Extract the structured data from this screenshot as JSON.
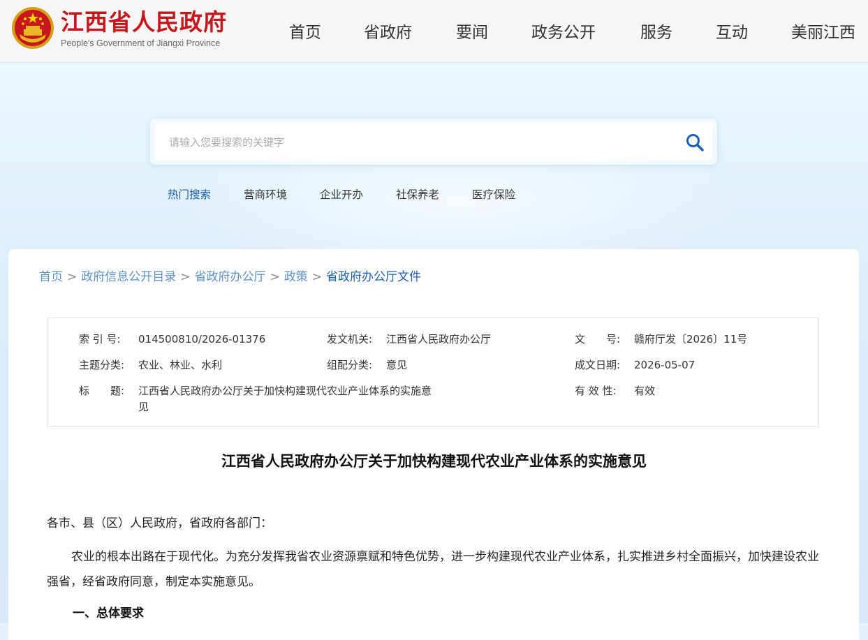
{
  "header": {
    "logo_cn": "江西省人民政府",
    "logo_en": "People's Government of Jiangxi Province",
    "nav": [
      "首页",
      "省政府",
      "要闻",
      "政务公开",
      "服务",
      "互动",
      "美丽江西"
    ]
  },
  "search": {
    "placeholder": "请输入您要搜索的关键字",
    "hot_label": "热门搜索",
    "hot_items": [
      "营商环境",
      "企业开办",
      "社保养老",
      "医疗保险"
    ]
  },
  "breadcrumb": {
    "items": [
      "首页",
      "政府信息公开目录",
      "省政府办公厅",
      "政策"
    ],
    "current": "省政府办公厅文件",
    "separator": ">"
  },
  "meta": {
    "index_label": "索 引 号:",
    "index_value": "014500810/2026-01376",
    "issuer_label": "发文机关:",
    "issuer_value": "江西省人民政府办公厅",
    "docno_label": "文　　号:",
    "docno_value": "赣府厅发〔2026〕11号",
    "topic_label": "主题分类:",
    "topic_value": "农业、林业、水利",
    "genre_label": "组配分类:",
    "genre_value": "意见",
    "date_label": "成文日期:",
    "date_value": "2026-05-07",
    "title_label": "标　　题:",
    "title_value": "江西省人民政府办公厅关于加快构建现代农业产业体系的实施意见",
    "validity_label": "有 效 性:",
    "validity_value": "有效"
  },
  "document": {
    "title": "江西省人民政府办公厅关于加快构建现代农业产业体系的实施意见",
    "salutation": "各市、县（区）人民政府，省政府各部门：",
    "intro": "农业的根本出路在于现代化。为充分发挥我省农业资源禀赋和特色优势，进一步构建现代农业产业体系，扎实推进乡村全面振兴，加快建设农业强省，经省政府同意，制定本实施意见。",
    "section1": "一、总体要求"
  },
  "colors": {
    "brand_red": "#c8161d",
    "link_blue": "#5a8fc8",
    "accent_blue": "#1a5fb4"
  },
  "icons": {
    "emblem": "national-emblem-icon",
    "search": "search-icon"
  }
}
